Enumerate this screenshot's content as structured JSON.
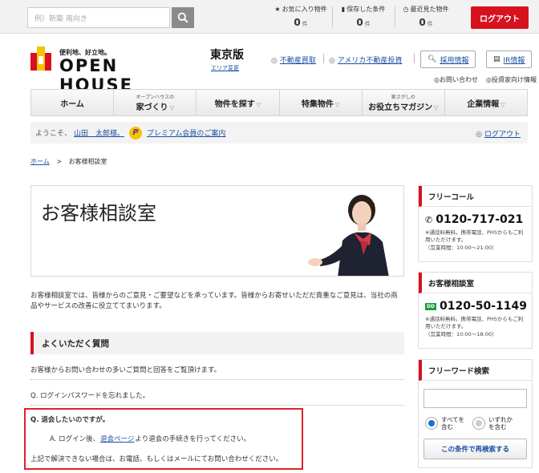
{
  "topbar": {
    "search_placeholder": "例）新築 南向き",
    "favorites": {
      "label": "お気に入り物件",
      "count": "0",
      "unit": "件"
    },
    "saved": {
      "label": "保存した条件",
      "count": "0",
      "unit": "件"
    },
    "recent": {
      "label": "最近見た物件",
      "count": "0",
      "unit": "件"
    },
    "logout_label": "ログアウト"
  },
  "header": {
    "logo_tagline": "便利地、好立地。",
    "logo_name": "OPEN HOUSE",
    "edition": "東京版",
    "area_change": "エリア変更",
    "links": [
      "不動産買取",
      "アメリカ不動産投資"
    ],
    "buttons": [
      "採用情報",
      "IR情報"
    ],
    "small_links": [
      "お問い合わせ",
      "投資家向け情報"
    ]
  },
  "nav": {
    "items": [
      {
        "sub": "",
        "label": "ホーム",
        "arrow": ""
      },
      {
        "sub": "オープンハウスの",
        "label": "家づくり",
        "arrow": "▽"
      },
      {
        "sub": "",
        "label": "物件を探す",
        "arrow": "▽"
      },
      {
        "sub": "",
        "label": "特集物件",
        "arrow": "▽"
      },
      {
        "sub": "家さがしの",
        "label": "お役立ちマガジン",
        "arrow": "▽"
      },
      {
        "sub": "",
        "label": "企業情報",
        "arrow": "▽"
      }
    ]
  },
  "welcome": {
    "prefix": "ようこそ、",
    "user": "山田　太郎様。",
    "premium_link": "プレミアム会員のご案内",
    "logout": "ログアウト"
  },
  "breadcrumb": {
    "home": "ホーム",
    "sep": ">",
    "current": "お客様相談室"
  },
  "hero": {
    "title": "お客様相談室"
  },
  "intro": "お客様相談室では、皆様からのご意見・ご要望などを承っています。皆様からお寄せいただだ貴重なご意見は、当社の商品やサービスの改善に役立ててまいります。",
  "faq": {
    "heading": "よくいただく質問",
    "description": "お客様からお問い合わせの多いご質問と回答をご覧頂けます。",
    "q1": "Q. ログインパスワードを忘れました。",
    "q2": "Q. 退会したいのですが。",
    "a2_before": "A. ログイン後、",
    "a2_link": "退会ページ",
    "a2_after": "より退会の手続きを行ってください。",
    "note": "上記で解決できない場合は、お電話、もしくはメールにてお問い合わせください。"
  },
  "sidebar": {
    "free_call": {
      "title": "フリーコール",
      "number": "0120-717-021",
      "note1": "※通話料無料。携帯電話、PHSからもご利用いただけます。",
      "hours": "（営業時間：10:00〜21:00）"
    },
    "consult": {
      "title": "お客様相談室",
      "dial_badge": "DD",
      "number": "0120-50-1149",
      "note1": "※通話料無料。携帯電話、PHSからもご利用いただけます。",
      "hours": "（営業時間：10:00〜18:00）"
    },
    "keyword": {
      "title": "フリーワード検索",
      "option_all": "すべてを\n含む",
      "option_any": "いずれか\nを含む",
      "button": "この条件で再検索する"
    }
  },
  "colors": {
    "accent": "#d7121f",
    "link": "#1a4fa3",
    "radio_on": "#1a6fd6"
  }
}
